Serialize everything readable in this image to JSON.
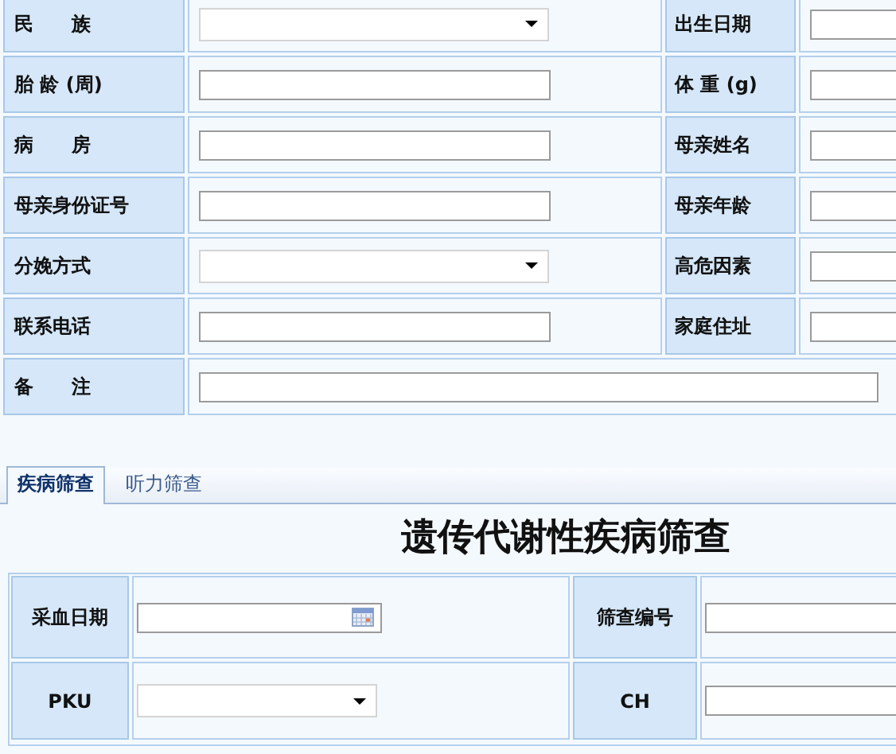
{
  "patient_form": {
    "rows": [
      {
        "cells": [
          {
            "label": "民　　族",
            "field": {
              "kind": "select"
            }
          },
          {
            "label": "出生日期",
            "field": {
              "kind": "text"
            }
          }
        ]
      },
      {
        "cells": [
          {
            "label": "胎 龄 (周)",
            "field": {
              "kind": "text"
            }
          },
          {
            "label": "体 重 (g)",
            "field": {
              "kind": "text"
            }
          }
        ]
      },
      {
        "cells": [
          {
            "label": "病　　房",
            "field": {
              "kind": "text"
            }
          },
          {
            "label": "母亲姓名",
            "field": {
              "kind": "text"
            }
          }
        ]
      },
      {
        "cells": [
          {
            "label": "母亲身份证号",
            "field": {
              "kind": "text"
            }
          },
          {
            "label": "母亲年龄",
            "field": {
              "kind": "text"
            }
          }
        ]
      },
      {
        "cells": [
          {
            "label": "分娩方式",
            "field": {
              "kind": "select"
            }
          },
          {
            "label": "高危因素",
            "field": {
              "kind": "text"
            }
          }
        ]
      },
      {
        "cells": [
          {
            "label": "联系电话",
            "field": {
              "kind": "text"
            }
          },
          {
            "label": "家庭住址",
            "field": {
              "kind": "text"
            }
          }
        ]
      },
      {
        "cells": [
          {
            "label": "备　　注",
            "field": {
              "kind": "wide"
            }
          }
        ]
      }
    ]
  },
  "tabs": [
    {
      "label": "疾病筛查",
      "selected": true
    },
    {
      "label": "听力筛查",
      "selected": false
    }
  ],
  "screening": {
    "title": "遗传代谢性疾病筛查",
    "rows": [
      {
        "cells": [
          {
            "label": "采血日期",
            "field": {
              "kind": "date"
            }
          },
          {
            "label": "筛查编号",
            "field": {
              "kind": "text"
            }
          }
        ]
      },
      {
        "cells": [
          {
            "label": "PKU",
            "field": {
              "kind": "select"
            }
          },
          {
            "label": "CH",
            "field": {
              "kind": "text"
            }
          }
        ]
      }
    ]
  }
}
